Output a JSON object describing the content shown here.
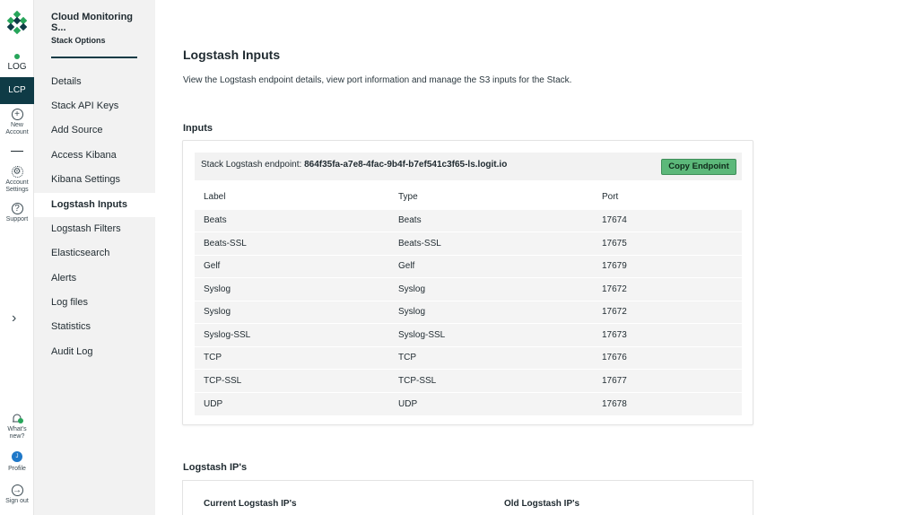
{
  "rail": {
    "log_label": "LOG",
    "lcp_label": "LCP",
    "new_account": [
      "New",
      "Account"
    ],
    "account_settings": [
      "Account",
      "Settings"
    ],
    "support": "Support",
    "whats_new": [
      "What's",
      "new?"
    ],
    "profile": "Profile",
    "sign_out": "Sign out",
    "avatar_initial": "J",
    "brand_colors": {
      "logo_green": "#27a55a",
      "logo_dark": "#0f3b46",
      "active_bg": "#0f3b46"
    }
  },
  "sidebar": {
    "title": "Cloud Monitoring S...",
    "subtitle": "Stack Options",
    "items": [
      {
        "label": "Details"
      },
      {
        "label": "Stack API Keys"
      },
      {
        "label": "Add Source"
      },
      {
        "label": "Access Kibana"
      },
      {
        "label": "Kibana Settings"
      },
      {
        "label": "Logstash Inputs",
        "active": true
      },
      {
        "label": "Logstash Filters"
      },
      {
        "label": "Elasticsearch"
      },
      {
        "label": "Alerts"
      },
      {
        "label": "Log files"
      },
      {
        "label": "Statistics"
      },
      {
        "label": "Audit Log"
      }
    ]
  },
  "main": {
    "title": "Logstash Inputs",
    "description": "View the Logstash endpoint details, view port information and manage the S3 inputs for the Stack.",
    "inputs_title": "Inputs",
    "endpoint_label": "Stack Logstash endpoint:",
    "endpoint_value": "864f35fa-a7e8-4fac-9b4f-b7ef541c3f65-ls.logit.io",
    "copy_button": "Copy Endpoint",
    "columns": [
      "Label",
      "Type",
      "Port"
    ],
    "rows": [
      [
        "Beats",
        "Beats",
        "17674"
      ],
      [
        "Beats-SSL",
        "Beats-SSL",
        "17675"
      ],
      [
        "Gelf",
        "Gelf",
        "17679"
      ],
      [
        "Syslog",
        "Syslog",
        "17672"
      ],
      [
        "Syslog",
        "Syslog",
        "17672"
      ],
      [
        "Syslog-SSL",
        "Syslog-SSL",
        "17673"
      ],
      [
        "TCP",
        "TCP",
        "17676"
      ],
      [
        "TCP-SSL",
        "TCP-SSL",
        "17677"
      ],
      [
        "UDP",
        "UDP",
        "17678"
      ]
    ],
    "ips_title": "Logstash IP's",
    "current_ips_label": "Current Logstash IP's",
    "old_ips_label": "Old Logstash IP's"
  }
}
